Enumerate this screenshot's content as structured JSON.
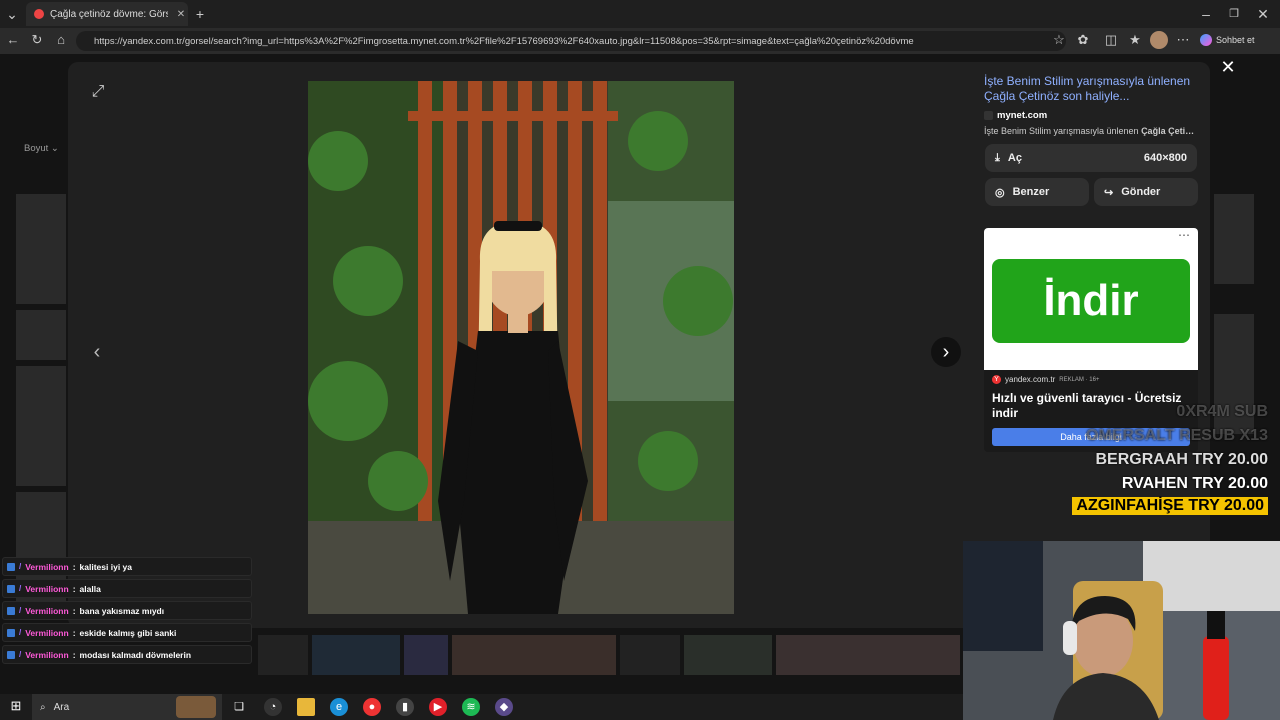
{
  "browser": {
    "tab_title": "Çağla çetinöz dövme: Görselleri g…",
    "tab_close": "✕",
    "new_tab": "+",
    "url": "https://yandex.com.tr/gorsel/search?img_url=https%3A%2F%2Fimgrosetta.mynet.com.tr%2Ffile%2F15769693%2F640xauto.jpg&lr=11508&pos=35&rpt=simage&text=çağla%20çetinöz%20dövme",
    "copilot_label": "Sohbet et"
  },
  "page": {
    "filter_label": "Boyut",
    "close_label": "✕",
    "prev_label": "‹",
    "next_label": "›",
    "expand_label": "⤢"
  },
  "side": {
    "title": "İşte Benim Stilim yarışmasıyla ünlenen Çağla Çetinöz son haliyle...",
    "site": "mynet.com",
    "snippet_prefix": "İşte Benim Stilim yarışmasıyla ünlenen ",
    "snippet_bold": "Çağla Çeti…",
    "open_label": "Aç",
    "dimensions": "640×800",
    "similar_label": "Benzer",
    "share_label": "Gönder"
  },
  "ad": {
    "button_text": "İndir",
    "site": "yandex.com.tr",
    "badge": "REKLAM · 16+",
    "title": "Hızlı ve güvenli tarayıcı - Ücretsiz indir",
    "cta": "Daha fazla bilgi",
    "menu": "⋯"
  },
  "chat": [
    {
      "user": "Vermilionn",
      "sep": ":",
      "text": "kalitesi iyi ya"
    },
    {
      "user": "Vermilionn",
      "sep": ":",
      "text": "alalla"
    },
    {
      "user": "Vermilionn",
      "sep": ":",
      "text": "bana yakısmaz mıydı"
    },
    {
      "user": "Vermilionn",
      "sep": ":",
      "text": "eskide kalmış gibi sanki"
    },
    {
      "user": "Vermilionn",
      "sep": ":",
      "text": "modası kalmadı dövmelerin"
    }
  ],
  "donations": [
    {
      "text": "0XR4M  SUB"
    },
    {
      "text": "OMERSALT  RESUB X13"
    },
    {
      "text": "BERGRAAH  TRY 20.00"
    },
    {
      "text": "RVAHEN  TRY 20.00"
    },
    {
      "text": "AZGINFAHİŞE  TRY 20.00"
    }
  ],
  "taskbar": {
    "search_placeholder": "Ara"
  },
  "colors": {
    "link": "#8fb0ff",
    "ad_green": "#21a41a",
    "ad_cta": "#4a7ee8",
    "chat_user": "#ff5ad9",
    "donation_highlight": "#f4c300"
  }
}
